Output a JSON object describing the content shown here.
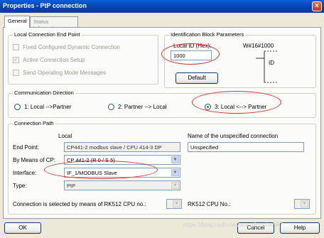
{
  "window": {
    "title": "Properties - PtP connection",
    "close_glyph": "×"
  },
  "tabs": [
    {
      "label": "General",
      "active": true
    },
    {
      "label": "Status Information",
      "active": false
    }
  ],
  "local_endpoint": {
    "title": "Local Connection End Point",
    "options": [
      {
        "label": "Fixed Configured Dynamic Connection",
        "checked": false
      },
      {
        "label": "Active Connection Setup",
        "checked": true
      },
      {
        "label": "Send Operating Mode Messages",
        "checked": false
      }
    ]
  },
  "id_block": {
    "title": "Identification Block Parameters",
    "local_id_label": "Local ID (Hex):",
    "local_id_value": "1000",
    "w_label": "W#16#1000",
    "id_box_label": "ID",
    "default_button": "Default"
  },
  "direction": {
    "title": "Communication Direction",
    "options": [
      {
        "label": "1: Local -->Partner",
        "selected": false
      },
      {
        "label": "2: Partner --> Local",
        "selected": false
      },
      {
        "label": "3: Local <--> Partner",
        "selected": true
      }
    ]
  },
  "path": {
    "title": "Connection Path",
    "local_header": "Local",
    "unspec_header": "Name of the unspecified connection",
    "end_point_label": "End Point:",
    "end_point_value": "CP441-2 modbus slave / CPU 414-3 DP",
    "unspec_value": "Unspecified",
    "by_means_label": "By Means of CP:",
    "by_means_value": "CP 441-2 (R 0 / S 5)",
    "interface_label": "Interface:",
    "interface_value": "IF_1/MODBUS Slave",
    "type_label": "Type:",
    "type_value": "PtP",
    "rk512_label": "Connection is selected by means of RK512  CPU no.:",
    "rk512_cpu_label": "RK512  CPU No.:"
  },
  "buttons": {
    "ok": "OK",
    "cancel": "Cancel",
    "help": "Help"
  },
  "watermark": "https://blog.csdn.net/wangjingchan87"
}
